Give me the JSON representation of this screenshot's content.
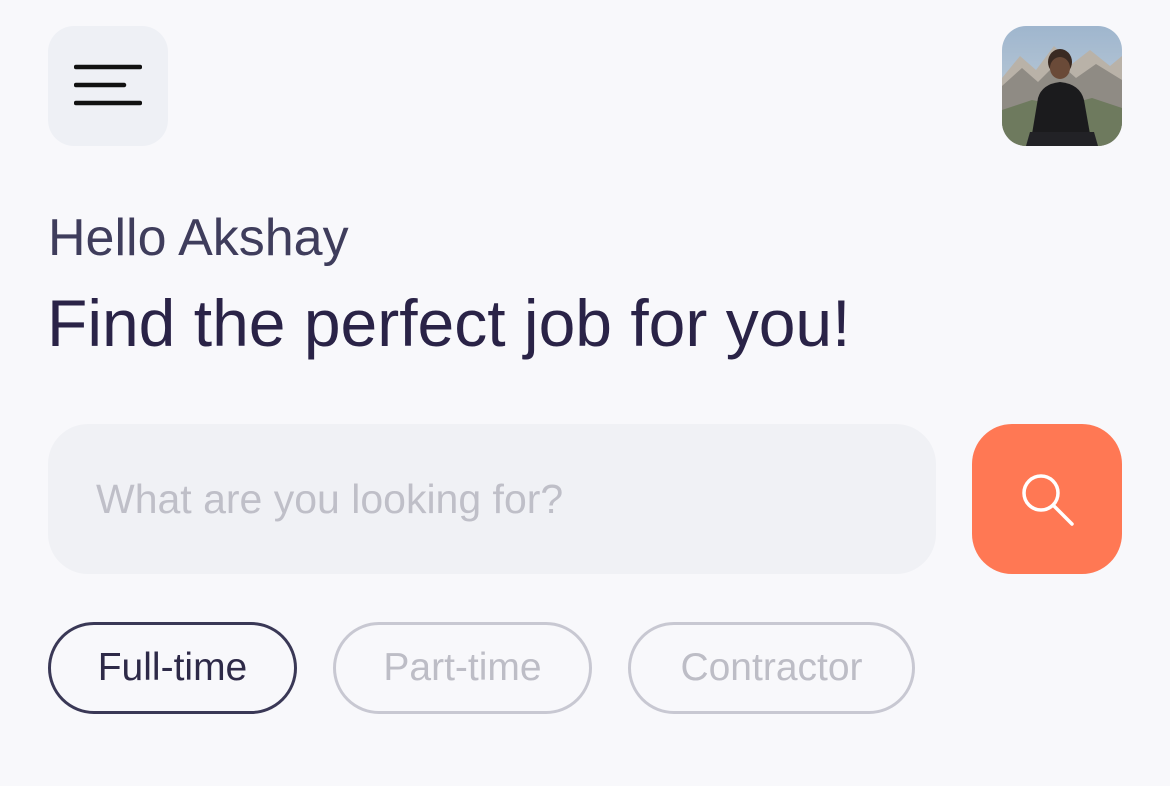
{
  "header": {
    "menu_icon": "menu-lines-icon",
    "avatar_icon": "user-avatar-photo"
  },
  "greeting": "Hello Akshay",
  "headline": "Find the perfect job for you!",
  "search": {
    "placeholder": "What are you looking for?",
    "value": "",
    "button_icon": "search-icon"
  },
  "filters": [
    {
      "label": "Full-time",
      "selected": true
    },
    {
      "label": "Part-time",
      "selected": false
    },
    {
      "label": "Contractor",
      "selected": false
    }
  ],
  "colors": {
    "background": "#F8F8FB",
    "accent": "#FF7854",
    "text_primary": "#2A2347",
    "text_secondary": "#3F3D5C",
    "placeholder": "#BFBFC8"
  }
}
